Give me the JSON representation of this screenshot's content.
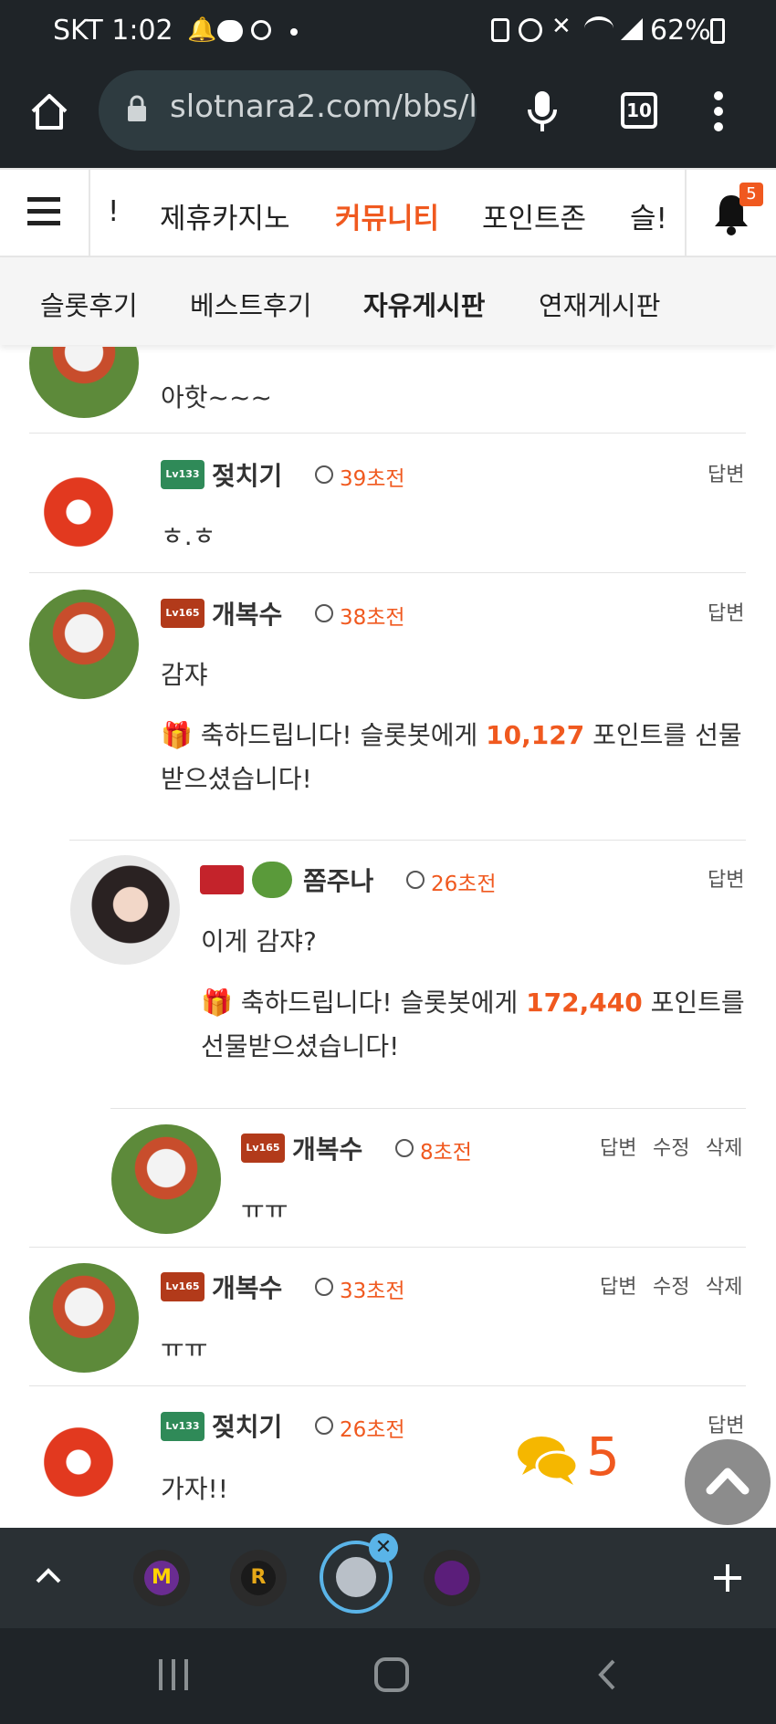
{
  "status_bar": {
    "carrier_time": "SKT 1:02",
    "battery": "62%"
  },
  "browser": {
    "url": "slotnara2.com/bbs/l",
    "tab_count": "10"
  },
  "nav_primary": {
    "items": [
      "!",
      "제휴카지노",
      "커뮤니티",
      "포인트존",
      "슬!"
    ],
    "active": "커뮤니티",
    "notification_count": "5"
  },
  "nav_secondary": {
    "items": [
      "슬롯후기",
      "베스트후기",
      "자유게시판",
      "연재게시판"
    ],
    "active": "자유게시판"
  },
  "comments": [
    {
      "name": "",
      "time": "",
      "body": "아핫~~~",
      "actions": []
    },
    {
      "name": "젖치기",
      "level": "133",
      "time": "39초전",
      "body": "ㅎ.ㅎ",
      "actions": [
        "답변"
      ]
    },
    {
      "name": "개복수",
      "level": "165",
      "time": "38초전",
      "body": "감쟈",
      "gift_prefix": "축하드립니다! 슬롯봇에게 ",
      "gift_points": "10,127",
      "gift_suffix_1": " 포인트를 선물",
      "gift_suffix_2": "받으셨습니다!",
      "actions": [
        "답변"
      ]
    },
    {
      "name": "쫌주나",
      "time": "26초전",
      "body": "이게 감쟈?",
      "gift_prefix": "축하드립니다! 슬롯봇에게 ",
      "gift_points": "172,440",
      "gift_suffix_1": " 포인트를",
      "gift_suffix_2": "선물받으셨습니다!",
      "actions": [
        "답변"
      ]
    },
    {
      "name": "개복수",
      "level": "165",
      "time": "8초전",
      "body": "ㅠㅠ",
      "actions": [
        "답변",
        "수정",
        "삭제"
      ]
    },
    {
      "name": "개복수",
      "level": "165",
      "time": "33초전",
      "body": "ㅠㅠ",
      "actions": [
        "답변",
        "수정",
        "삭제"
      ]
    },
    {
      "name": "젖치기",
      "level": "133",
      "time": "26초전",
      "body": "가자!!",
      "actions": [
        "답변"
      ]
    }
  ],
  "floating": {
    "comment_count": "5"
  },
  "colors": {
    "accent": "#f0591f",
    "dark_bar": "#1f2428"
  }
}
